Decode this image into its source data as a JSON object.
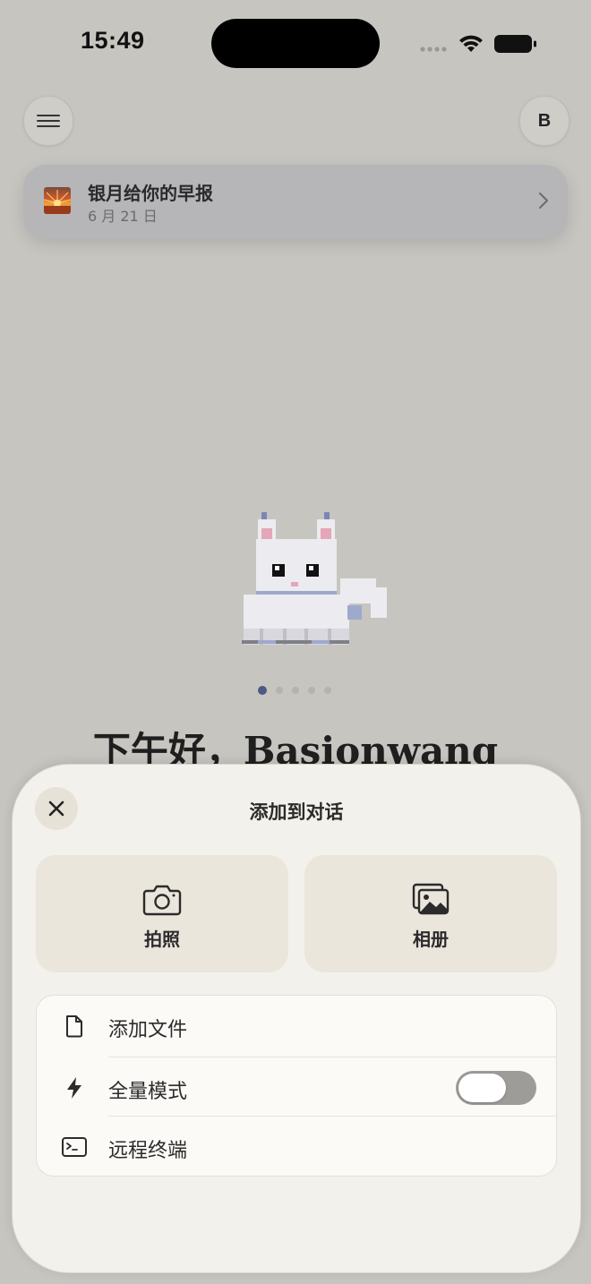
{
  "status_bar": {
    "time": "15:49"
  },
  "header": {
    "avatar_initial": "B"
  },
  "brief": {
    "title": "银月给你的早报",
    "date": "6 月 21 日"
  },
  "carousel": {
    "page_count": 5,
    "active_index": 0
  },
  "greeting": "下午好，Basionwang",
  "sheet": {
    "title": "添加到对话",
    "actions": [
      {
        "label": "拍照",
        "icon": "camera-icon"
      },
      {
        "label": "相册",
        "icon": "photo-library-icon"
      }
    ],
    "options": [
      {
        "label": "添加文件",
        "icon": "file-icon"
      },
      {
        "label": "全量模式",
        "icon": "lightning-icon",
        "toggle_on": false
      },
      {
        "label": "远程终端",
        "icon": "terminal-icon"
      }
    ]
  }
}
